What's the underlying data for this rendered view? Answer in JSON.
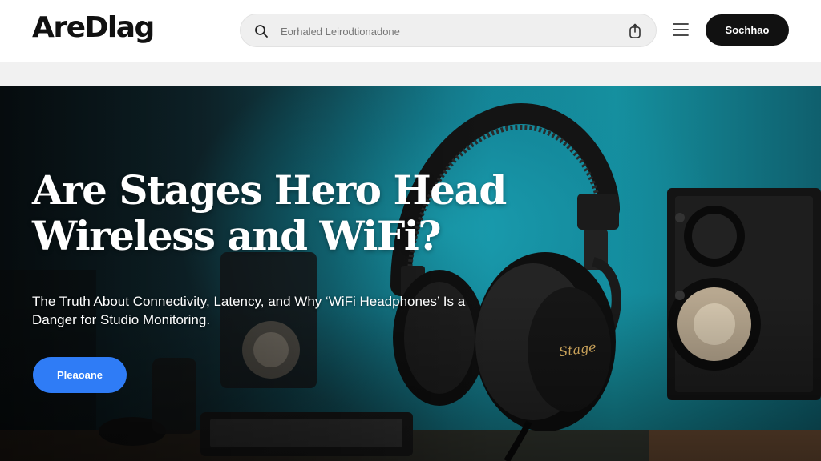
{
  "header": {
    "logo": "AreDlag",
    "search": {
      "placeholder": "Eorhaled Leirodtionadone"
    },
    "cta_label": "Sochhao"
  },
  "hero": {
    "title": "Are Stages Hero Head Wireless and WiFi?",
    "subtitle": "The Truth About Connectivity, Latency, and Why ‘WiFi Headphones’ Is a Danger for Studio Monitoring.",
    "button_label": "Pleaoane",
    "headphone_brand": "Stage"
  },
  "colors": {
    "accent": "#2f7cf6",
    "dark_button": "#111111",
    "hero_teal": "#15909f"
  },
  "icons": [
    "search-icon",
    "share-icon",
    "hamburger-menu-icon"
  ]
}
